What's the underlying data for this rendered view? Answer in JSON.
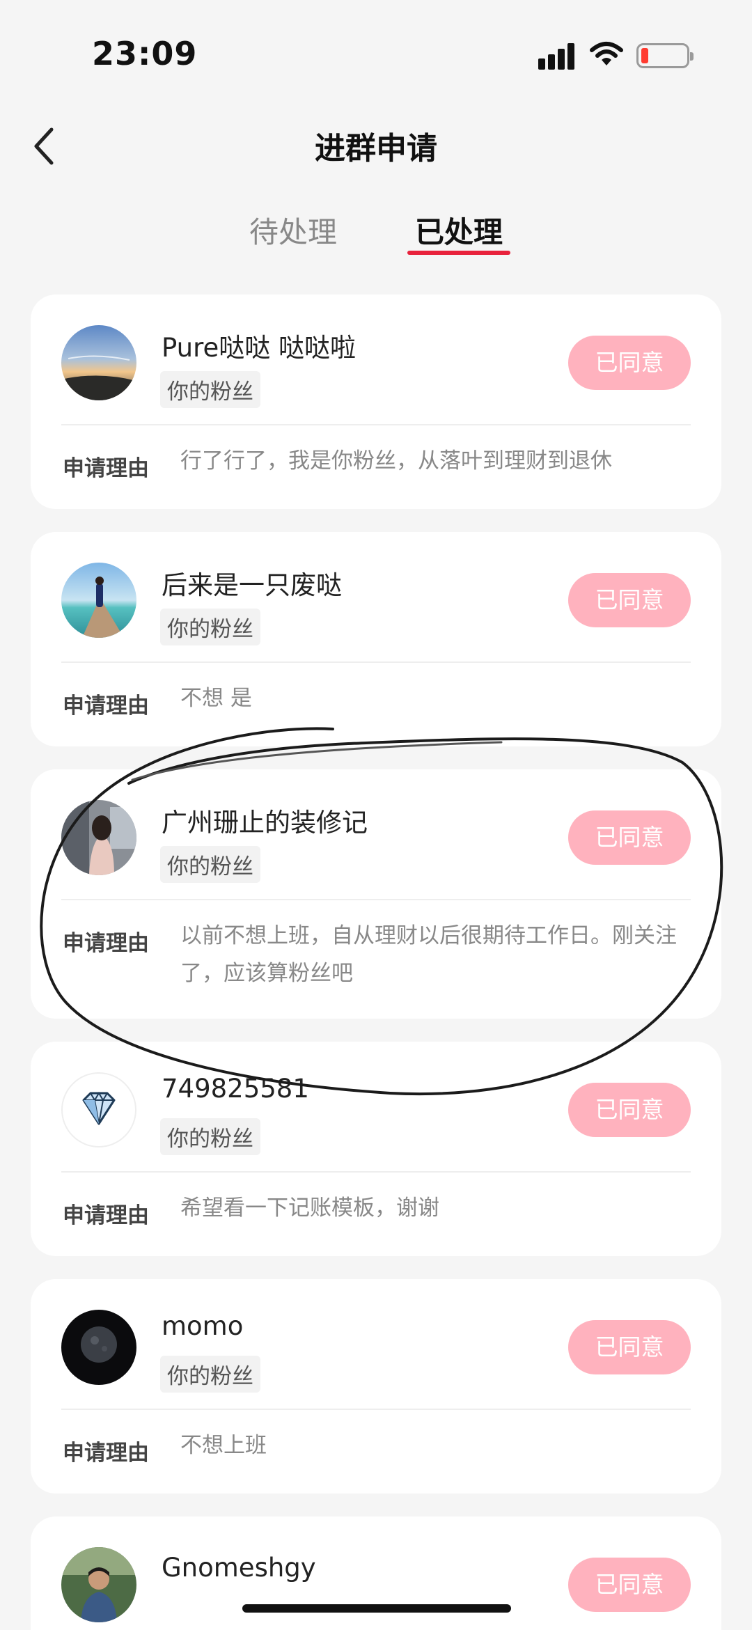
{
  "status_bar": {
    "time": "23:09"
  },
  "header": {
    "title": "进群申请"
  },
  "tabs": [
    {
      "label": "待处理",
      "active": false
    },
    {
      "label": "已处理",
      "active": true
    }
  ],
  "colors": {
    "accent": "#e8223c",
    "button": "#ffb2be",
    "page_bg": "#f5f5f5",
    "battery_low": "#ff3b30"
  },
  "reason_label": "申请理由",
  "applications": [
    {
      "name": "Pure哒哒 哒哒啦",
      "tag": "你的粉丝",
      "button": "已同意",
      "reason": "行了行了，我是你粉丝，从落叶到理财到退休",
      "avatar": "sunset-photo"
    },
    {
      "name": "后来是一只废哒",
      "tag": "你的粉丝",
      "button": "已同意",
      "reason": "不想 是",
      "avatar": "beach-pier-photo"
    },
    {
      "name": "广州珊止的装修记",
      "tag": "你的粉丝",
      "button": "已同意",
      "reason": "以前不想上班，自从理财以后很期待工作日。刚关注了，应该算粉丝吧",
      "avatar": "street-portrait-photo"
    },
    {
      "name": "749825581",
      "tag": "你的粉丝",
      "button": "已同意",
      "reason": "希望看一下记账模板，谢谢",
      "avatar": "diamond-icon"
    },
    {
      "name": "momo",
      "tag": "你的粉丝",
      "button": "已同意",
      "reason": "不想上班",
      "avatar": "moon-photo"
    },
    {
      "name": "Gnomeshgy",
      "button": "已同意",
      "avatar": "man-portrait-photo"
    }
  ]
}
